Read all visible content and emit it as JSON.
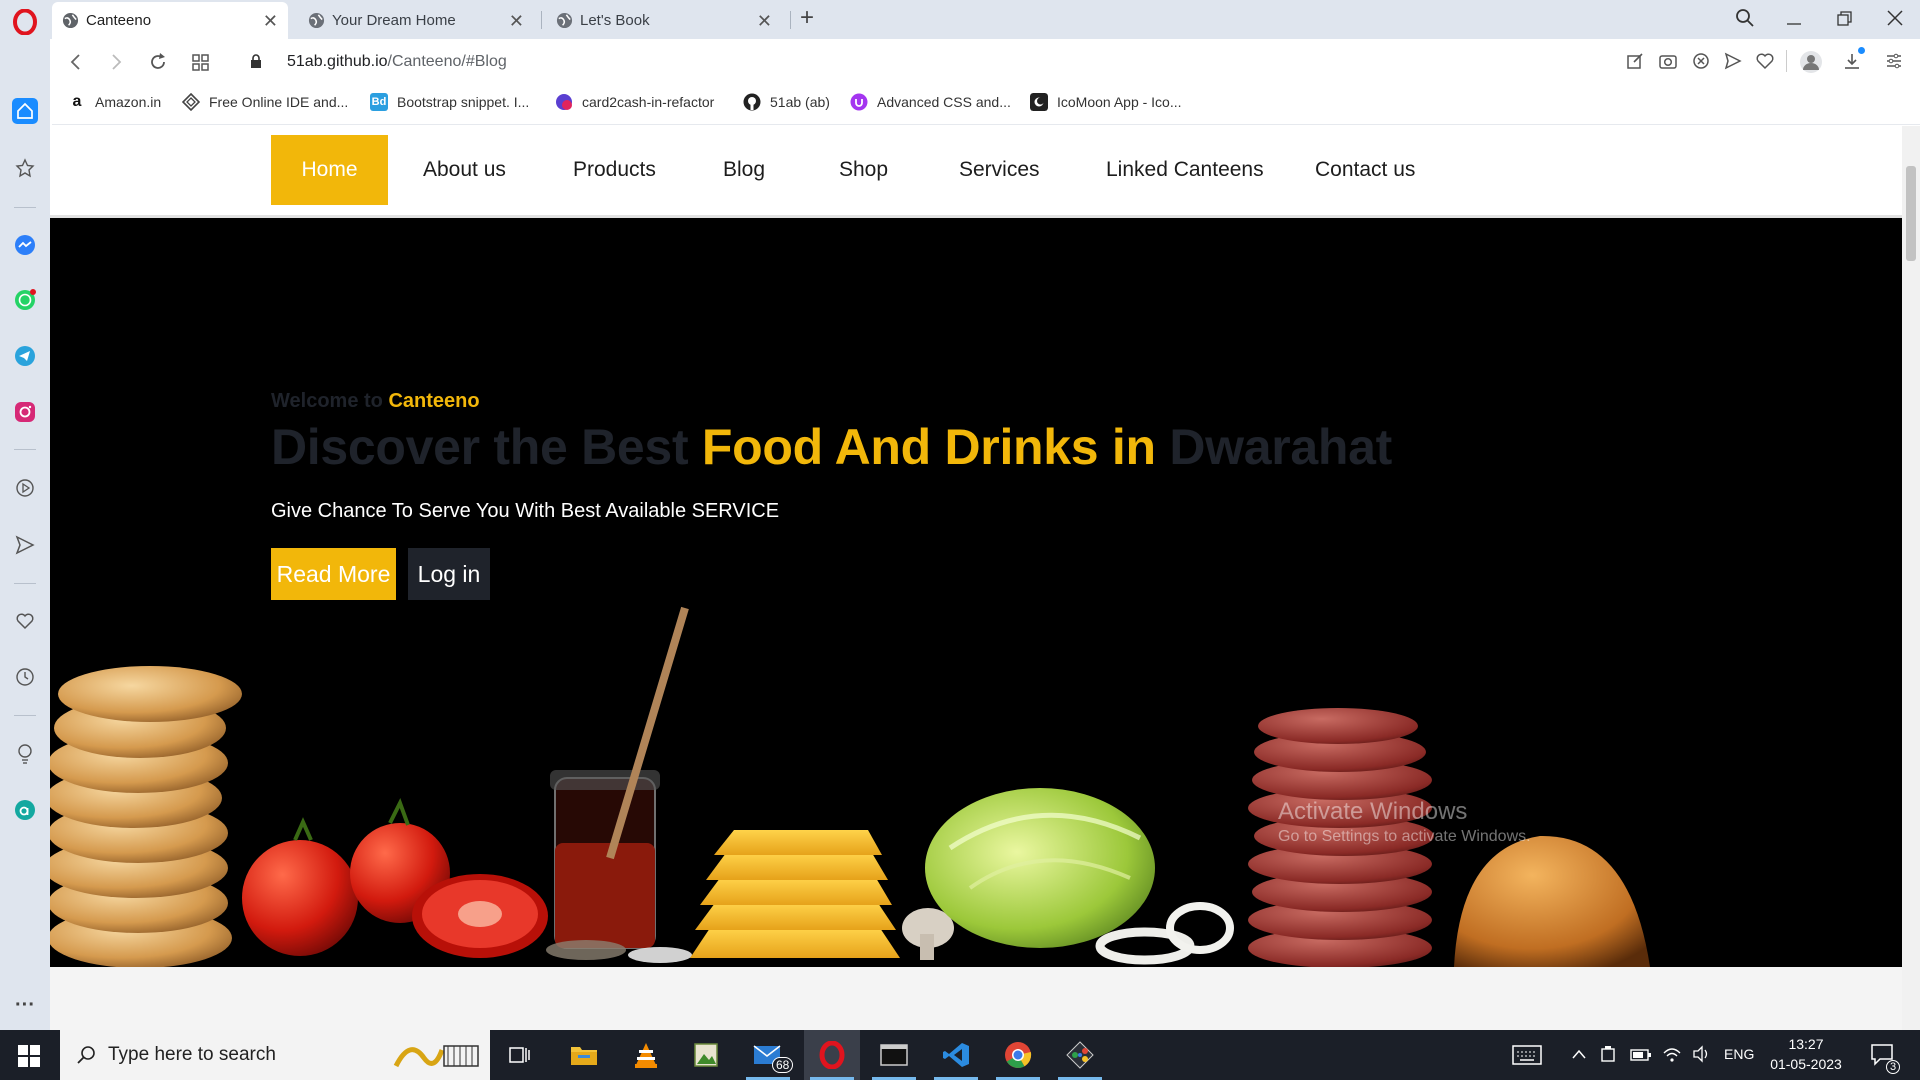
{
  "browser": {
    "tabs": [
      {
        "title": "Canteeno",
        "active": true
      },
      {
        "title": "Your Dream Home",
        "active": false
      },
      {
        "title": "Let's Book",
        "active": false
      }
    ],
    "url_host": "51ab.github.io",
    "url_path": "/Canteeno/#Blog",
    "bookmarks": [
      {
        "label": "Amazon.in",
        "icon": "amazon-icon"
      },
      {
        "label": "Free Online IDE and...",
        "icon": "ide-icon"
      },
      {
        "label": "Bootstrap snippet. I...",
        "icon": "bootdey-icon"
      },
      {
        "label": "card2cash-in-refactor",
        "icon": "card2cash-icon"
      },
      {
        "label": "51ab (ab)",
        "icon": "github-icon"
      },
      {
        "label": "Advanced CSS and...",
        "icon": "udemy-icon"
      },
      {
        "label": "IcoMoon App - Ico...",
        "icon": "icomoon-icon"
      }
    ],
    "bookmark_fav_text": {
      "bootdey": "Bd"
    }
  },
  "site": {
    "nav": [
      {
        "label": "Home"
      },
      {
        "label": "About us"
      },
      {
        "label": "Products"
      },
      {
        "label": "Blog"
      },
      {
        "label": "Shop"
      },
      {
        "label": "Services"
      },
      {
        "label": "Linked Canteens"
      },
      {
        "label": "Contact us"
      }
    ],
    "hero": {
      "welcome_prefix": "Welcome to ",
      "welcome_brand": "Canteeno",
      "headline_part1": "Discover the Best ",
      "headline_highlight": "Food And Drinks in ",
      "headline_part2": "Dwarahat",
      "subline": "Give Chance To Serve You With Best Available SERVICE",
      "read_more": "Read More",
      "login": "Log in"
    },
    "colors": {
      "accent": "#f2b70a",
      "dark": "#1f232b",
      "hero_bg": "#000000"
    }
  },
  "watermark": {
    "line1": "Activate Windows",
    "line2": "Go to Settings to activate Windows."
  },
  "taskbar": {
    "search_placeholder": "Type here to search",
    "mail_badge": "68",
    "language": "ENG",
    "time": "13:27",
    "date": "01-05-2023",
    "notification_count": "3"
  }
}
